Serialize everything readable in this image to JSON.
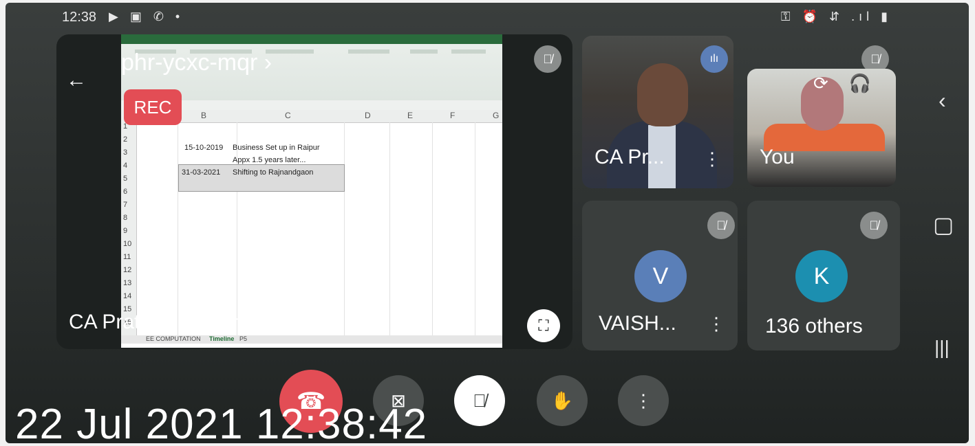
{
  "status_bar": {
    "time": "12:38",
    "left_icons": "▶ ▣ ✆ •",
    "right_icons": "⚿ ⏰ ⇵ .ıl ▮"
  },
  "meeting": {
    "code": "phr-ycxc-mqr ›",
    "rec_label": "REC",
    "presenting_text": "CA Pratik is presenting"
  },
  "spreadsheet": {
    "columns": [
      "B",
      "C",
      "D",
      "E",
      "F",
      "G"
    ],
    "rows": [
      "1",
      "2",
      "3",
      "4",
      "5",
      "6",
      "7",
      "8",
      "9",
      "10",
      "11",
      "12",
      "13",
      "14",
      "15",
      "16"
    ],
    "cells": {
      "r2_b": "15-10-2019",
      "r2_c": "Business Set up in Raipur",
      "r3_c": "Appx 1.5 years later...",
      "r4_b": "31-03-2021",
      "r4_c": "Shifting to Rajnandgaon"
    },
    "sheet_tabs": [
      "EE COMPUTATION",
      "Timeline",
      "P5"
    ]
  },
  "participants": [
    {
      "name": "CA Pr...",
      "type": "video"
    },
    {
      "name": "You",
      "type": "video"
    },
    {
      "name": "VAISH...",
      "initial": "V",
      "avatar_color": "#5a7fb8"
    },
    {
      "name": "136 others",
      "initial": "K",
      "avatar_color": "#1c8fb0"
    }
  ],
  "controls": {
    "hangup": "end-call",
    "camera": "camera-off",
    "mic": "mic-off",
    "raise_hand": "raise-hand",
    "more": "more-options"
  },
  "timestamp": "22 Jul 2021 12:38:42",
  "colors": {
    "rec": "#e34d55",
    "hangup": "#e34d55",
    "avatar_v": "#5a7fb8",
    "avatar_k": "#1c8fb0"
  }
}
